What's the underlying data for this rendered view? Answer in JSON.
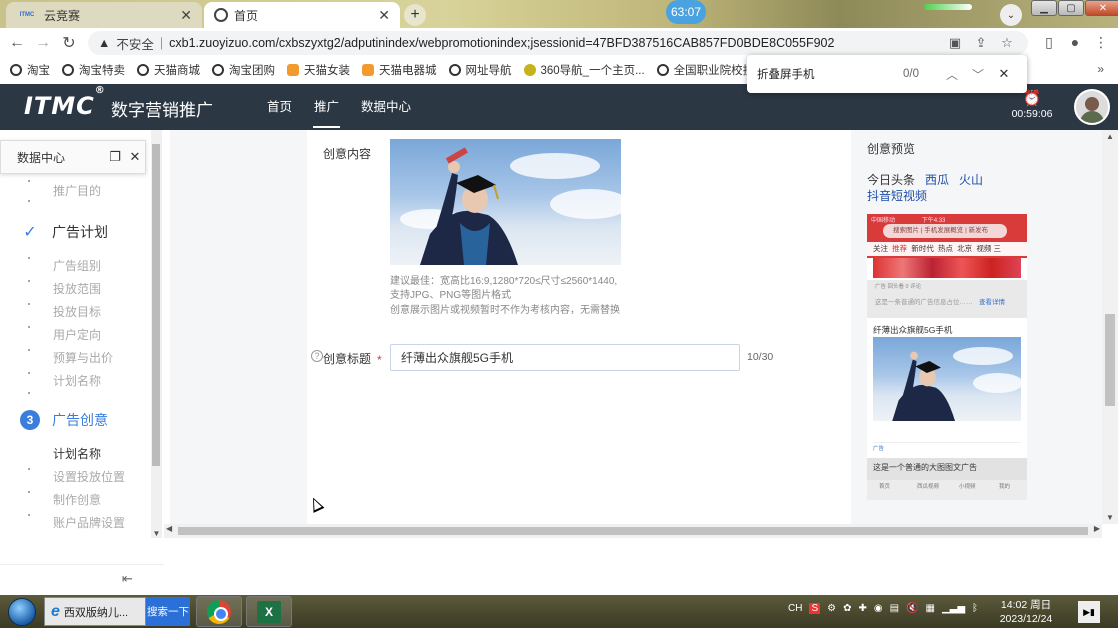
{
  "browser": {
    "tabs": [
      {
        "label": "云竞赛",
        "favicon": "ITMC",
        "active": false
      },
      {
        "label": "首页",
        "active": true
      }
    ],
    "timer_bubble": "63:07",
    "nav": {
      "back": "←",
      "forward": "→",
      "reload": "↻"
    },
    "address": {
      "security_label": "不安全",
      "url": "cxb1.zuoyizuo.com/cxbszyxtg2/adputinindex/webpromotionindex;jsessionid=47BFD387516CAB857FD0BDE8C055F902"
    },
    "bookmarks": [
      "淘宝",
      "淘宝特卖",
      "天猫商城",
      "淘宝团购",
      "天猫女装",
      "天猫电器城",
      "网址导航",
      "360导航_一个主页...",
      "全国职业院校技能..."
    ],
    "bookmarks_more": "»",
    "find": {
      "query": "折叠屏手机",
      "count": "0/0"
    }
  },
  "app": {
    "logo": "ITMC",
    "logo_mark": "®",
    "name": "数字营销推广",
    "nav": [
      {
        "label": "首页",
        "active": false
      },
      {
        "label": "推广",
        "active": true
      },
      {
        "label": "数据中心",
        "active": false
      }
    ],
    "countdown": "00:59:06"
  },
  "sidebar": {
    "panel_title": "数据中心",
    "steps": [
      {
        "type": "sub",
        "label": "推广目的",
        "style": "muted"
      },
      {
        "type": "step",
        "label": "广告计划",
        "state": "done",
        "marker": "✓"
      },
      {
        "type": "sub",
        "label": "广告组别",
        "style": "muted"
      },
      {
        "type": "sub",
        "label": "投放范围",
        "style": "muted"
      },
      {
        "type": "sub",
        "label": "投放目标",
        "style": "muted"
      },
      {
        "type": "sub",
        "label": "用户定向",
        "style": "muted"
      },
      {
        "type": "sub",
        "label": "预算与出价",
        "style": "muted"
      },
      {
        "type": "sub",
        "label": "计划名称",
        "style": "muted"
      },
      {
        "type": "step",
        "label": "广告创意",
        "state": "current",
        "marker": "3"
      },
      {
        "type": "sub",
        "label": "计划名称",
        "style": "dark"
      },
      {
        "type": "sub",
        "label": "设置投放位置",
        "style": "muted"
      },
      {
        "type": "sub",
        "label": "制作创意",
        "style": "muted"
      },
      {
        "type": "sub",
        "label": "账户品牌设置",
        "style": "muted"
      }
    ]
  },
  "form": {
    "content_label": "创意内容",
    "hint_lines": [
      "建议最佳：宽高比16:9,1280*720≤尺寸≤2560*1440,",
      "支持JPG、PNG等图片格式",
      "创意展示图片或视频暂时不作为考核内容，无需替换"
    ],
    "title_label": "创意标题",
    "required_mark": "*",
    "title_value": "纤薄出众旗舰5G手机",
    "title_counter": "10/30"
  },
  "preview": {
    "heading": "创意预览",
    "platforms": [
      {
        "label": "今日头条",
        "active": true
      },
      {
        "label": "西瓜",
        "active": false
      },
      {
        "label": "火山",
        "active": false
      },
      {
        "label": "抖音短视频",
        "active": false
      }
    ],
    "phone": {
      "status_left": "中国移动",
      "status_time": "下午4:33",
      "search_text": "搜索图片 | 手机发展概览 | 新发布",
      "menu": [
        "关注",
        "推荐",
        "新时代",
        "热点",
        "北京",
        "视频",
        "三"
      ],
      "menu_active": "推荐",
      "feed_meta": "广告 回头看  0 评论",
      "feed_text": "这是一条普通的广告信息占位……",
      "feed_link": "查看详情",
      "ad_title": "纤薄出众旗舰5G手机",
      "ad_tag": "广告",
      "next_title": "这是一个普通的大图图文广告",
      "bottom_nav": [
        "首页",
        "西瓜视频",
        "小视频",
        "我的"
      ]
    }
  },
  "taskbar": {
    "ie_label": "西双版纳儿...",
    "search_label": "搜索一下",
    "lang": "CH",
    "time": "14:02 周日",
    "date": "2023/12/24"
  },
  "colors": {
    "header_bg": "#2c3744",
    "accent_blue": "#3b7ddd",
    "link_blue": "#1f4ea8",
    "required_red": "#ee3333"
  }
}
